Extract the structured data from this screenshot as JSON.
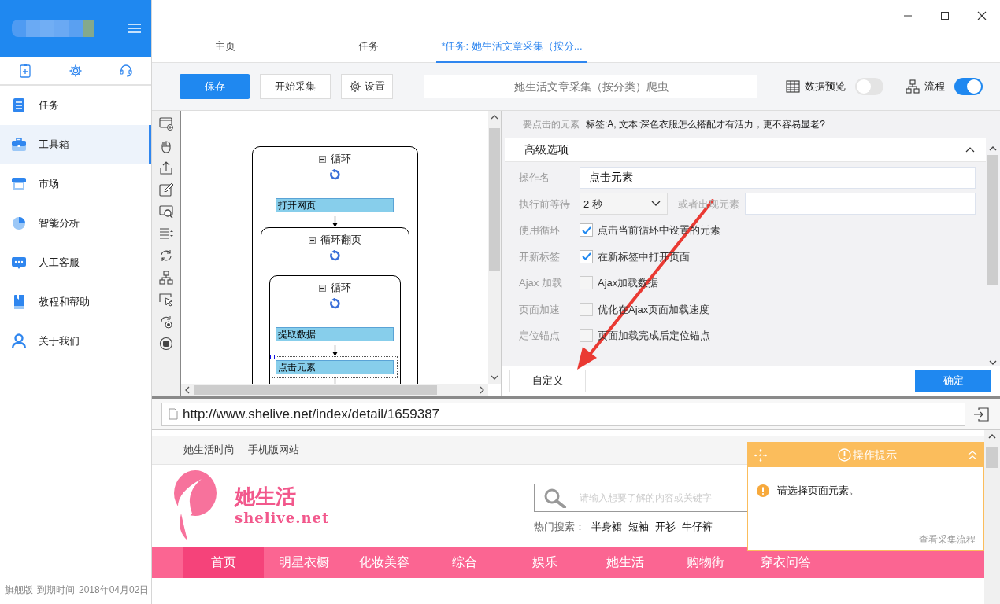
{
  "sidebar": {
    "items": [
      {
        "label": "任务",
        "selected": false
      },
      {
        "label": "工具箱",
        "selected": true
      },
      {
        "label": "市场",
        "selected": false
      },
      {
        "label": "智能分析",
        "selected": false
      },
      {
        "label": "人工客服",
        "selected": false
      },
      {
        "label": "教程和帮助",
        "selected": false
      },
      {
        "label": "关于我们",
        "selected": false
      }
    ],
    "footer": {
      "edition": "旗舰版",
      "expiry_label": "到期时间",
      "expiry_date": "2018年04月02日"
    }
  },
  "tabs": [
    {
      "label": "主页",
      "selected": false
    },
    {
      "label": "任务",
      "selected": false
    },
    {
      "label": "*任务: 她生活文章采集（按分...",
      "selected": true
    }
  ],
  "toolbar": {
    "buttons": [
      {
        "label": "保存",
        "kind": "primary"
      },
      {
        "label": "开始采集",
        "kind": "default"
      },
      {
        "label": "设置",
        "kind": "settings"
      }
    ],
    "task_name": "她生活文章采集（按分类）爬虫",
    "toggles": [
      {
        "label": "数据预览",
        "kind": "table",
        "on": false
      },
      {
        "label": "流程",
        "kind": "flow",
        "on": true
      }
    ]
  },
  "flow": {
    "nodes": [
      {
        "kind": "loop",
        "label": "循环",
        "expanded": true,
        "selected": false,
        "children": [
          {
            "kind": "action",
            "label": "打开网页",
            "selected": false
          },
          {
            "kind": "loop",
            "label": "循环翻页",
            "expanded": true,
            "selected": false,
            "children": [
              {
                "kind": "loop",
                "label": "循环",
                "expanded": true,
                "selected": false,
                "children": [
                  {
                    "kind": "action",
                    "label": "提取数据",
                    "selected": false
                  },
                  {
                    "kind": "action",
                    "label": "点击元素",
                    "selected": true
                  }
                ]
              }
            ]
          }
        ]
      }
    ]
  },
  "options": {
    "target_label": "要点击的元素",
    "target_value": "标签:A, 文本:深色衣服怎么搭配才有活力，更不容易显老?",
    "section_title": "高级选项",
    "section_expanded": true,
    "fields": [
      {
        "kind": "text",
        "label": "操作名",
        "value": "点击元素"
      },
      {
        "kind": "wait",
        "label": "执行前等待",
        "value": "2 秒",
        "or_label": "或者出现元素"
      },
      {
        "kind": "checkbox",
        "label": "使用循环",
        "option": "点击当前循环中设置的元素",
        "checked": true
      },
      {
        "kind": "checkbox",
        "label": "开新标签",
        "option": "在新标签中打开页面",
        "checked": true
      },
      {
        "kind": "checkbox",
        "label": "Ajax 加载",
        "option": "Ajax加载数据",
        "checked": false
      },
      {
        "kind": "checkbox",
        "label": "页面加速",
        "option": "优化在Ajax页面加载速度",
        "checked": false
      },
      {
        "kind": "checkbox",
        "label": "定位锚点",
        "option": "页面加载完成后定位锚点",
        "checked": false
      }
    ],
    "buttons": [
      {
        "label": "自定义",
        "kind": "default"
      },
      {
        "label": "确定",
        "kind": "primary"
      }
    ]
  },
  "browser": {
    "url": "http://www.shelive.net/index/detail/1659387"
  },
  "website": {
    "top_links": [
      "她生活时尚",
      "手机版网站"
    ],
    "logo_name": "她生活",
    "logo_domain": "shelive.net",
    "search_placeholder": "请输入想要了解的内容或关键字",
    "hot_label": "热门搜索：",
    "hot_terms": [
      "半身裙",
      "短袖",
      "开衫",
      "牛仔裤"
    ],
    "nav": [
      {
        "label": "首页",
        "selected": true
      },
      {
        "label": "明星衣橱",
        "selected": false
      },
      {
        "label": "化妆美容",
        "selected": false
      },
      {
        "label": "综合",
        "selected": false
      },
      {
        "label": "娱乐",
        "selected": false
      },
      {
        "label": "她生活",
        "selected": false
      },
      {
        "label": "购物街",
        "selected": false
      },
      {
        "label": "穿衣问答",
        "selected": false
      }
    ]
  },
  "tip": {
    "title": "操作提示",
    "message": "请选择页面元素。",
    "link": "查看采集流程"
  }
}
